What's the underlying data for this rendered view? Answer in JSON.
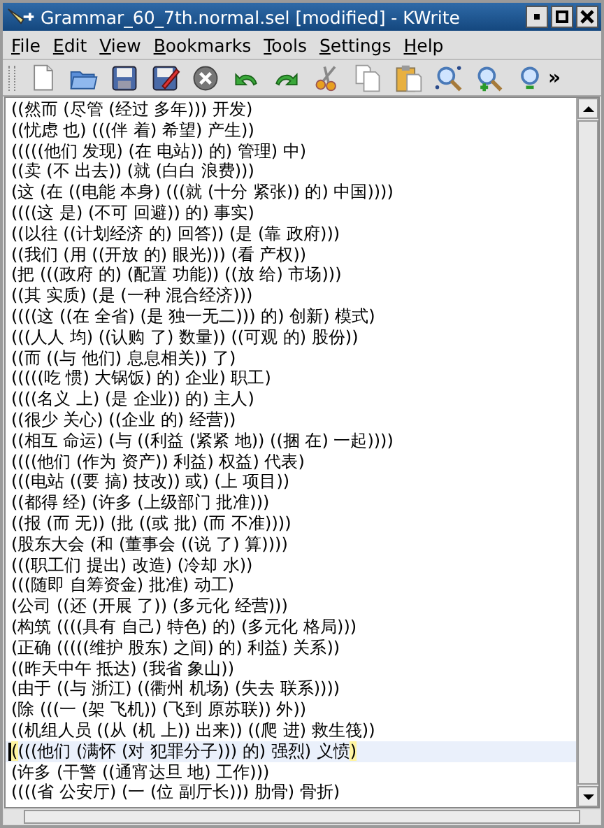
{
  "window": {
    "title": "Grammar_60_7th.normal.sel [modified] - KWrite"
  },
  "menu": [
    {
      "label": "File"
    },
    {
      "label": "Edit"
    },
    {
      "label": "View"
    },
    {
      "label": "Bookmarks"
    },
    {
      "label": "Tools"
    },
    {
      "label": "Settings"
    },
    {
      "label": "Help"
    }
  ],
  "toolbar": {
    "buttons": [
      {
        "kind": "new"
      },
      {
        "kind": "open"
      },
      {
        "kind": "save"
      },
      {
        "kind": "saveas"
      },
      {
        "kind": "close"
      },
      {
        "kind": "undo"
      },
      {
        "kind": "redo"
      },
      {
        "kind": "cut"
      },
      {
        "kind": "copy"
      },
      {
        "kind": "paste"
      },
      {
        "kind": "find"
      },
      {
        "kind": "zoomin"
      },
      {
        "kind": "zoomout"
      }
    ],
    "overflow": "»"
  },
  "editor": {
    "lines": [
      {
        "text": "((然而 (尽管 (经过 多年))) 开发)",
        "current": false
      },
      {
        "text": "((忧虑 也) (((伴 着) 希望) 产生))",
        "current": false
      },
      {
        "text": "(((((他们 发现) (在 电站)) 的) 管理) 中)",
        "current": false
      },
      {
        "text": "((卖 (不 出去)) (就 (白白 浪费)))",
        "current": false
      },
      {
        "text": "(这 (在 ((电能 本身) (((就 (十分 紧张)) 的) 中国))))",
        "current": false
      },
      {
        "text": "((((这 是) (不可 回避)) 的) 事实)",
        "current": false
      },
      {
        "text": "((以往 ((计划经济 的) 回答)) (是 (靠 政府)))",
        "current": false
      },
      {
        "text": "((我们 (用 ((开放 的) 眼光))) (看 产权))",
        "current": false
      },
      {
        "text": "(把 (((政府 的) (配置 功能)) ((放 给) 市场)))",
        "current": false
      },
      {
        "text": "((其 实质) (是 (一种 混合经济)))",
        "current": false
      },
      {
        "text": "((((这 ((在 全省) (是 独一无二))) 的) 创新) 模式)",
        "current": false
      },
      {
        "text": "(((人人 均) ((认购 了) 数量)) ((可观 的) 股份))",
        "current": false
      },
      {
        "text": "((而 ((与 他们) 息息相关)) 了)",
        "current": false
      },
      {
        "text": "(((((吃 惯) 大锅饭) 的) 企业) 职工)",
        "current": false
      },
      {
        "text": "((((名义 上) (是 企业)) 的) 主人)",
        "current": false
      },
      {
        "text": "((很少 关心) ((企业 的) 经营))",
        "current": false
      },
      {
        "text": "((相互 命运) (与 ((利益 (紧紧 地)) ((捆 在) 一起))))",
        "current": false
      },
      {
        "text": "((((他们 (作为 资产)) 利益) 权益) 代表)",
        "current": false
      },
      {
        "text": "(((电站 ((要 搞) 技改)) 或) (上 项目))",
        "current": false
      },
      {
        "text": "((都得 经) (许多 (上级部门 批准)))",
        "current": false
      },
      {
        "text": "((报 (而 无)) (批 ((或 批) (而 不准))))",
        "current": false
      },
      {
        "text": "(股东大会 (和 (董事会 ((说 了) 算))))",
        "current": false
      },
      {
        "text": "(((职工们 提出) 改造) (冷却 水))",
        "current": false
      },
      {
        "text": "(((随即 自筹资金) 批准) 动工)",
        "current": false
      },
      {
        "text": "(公司 ((还 (开展 了)) (多元化 经营)))",
        "current": false
      },
      {
        "text": "(构筑 ((((具有 自己) 特色) 的) (多元化 格局)))",
        "current": false
      },
      {
        "text": "(正确 (((((维护 股东) 之间) 的) 利益) 关系))",
        "current": false
      },
      {
        "text": "((昨天中午 抵达) (我省 象山))",
        "current": false
      },
      {
        "text": "(由于 ((与 浙江) ((衢州 机场) (失去 联系))))",
        "current": false
      },
      {
        "text": "(除 (((一 (架 飞机)) (飞到 原苏联)) 外))",
        "current": false
      },
      {
        "text": "((机组人员 ((从 (机 上)) 出来)) ((爬 进) 救生筏))",
        "current": false
      },
      {
        "text": "((((他们 (满怀 (对 犯罪分子))) 的) 强烈) 义愤)",
        "current": true
      },
      {
        "text": "(许多 (干警 ((通宵达旦 地) 工作)))",
        "current": false
      },
      {
        "text": "((((省 公安厅) (一 (位 副厅长))) 肋骨) 骨折)",
        "current": false
      }
    ]
  }
}
